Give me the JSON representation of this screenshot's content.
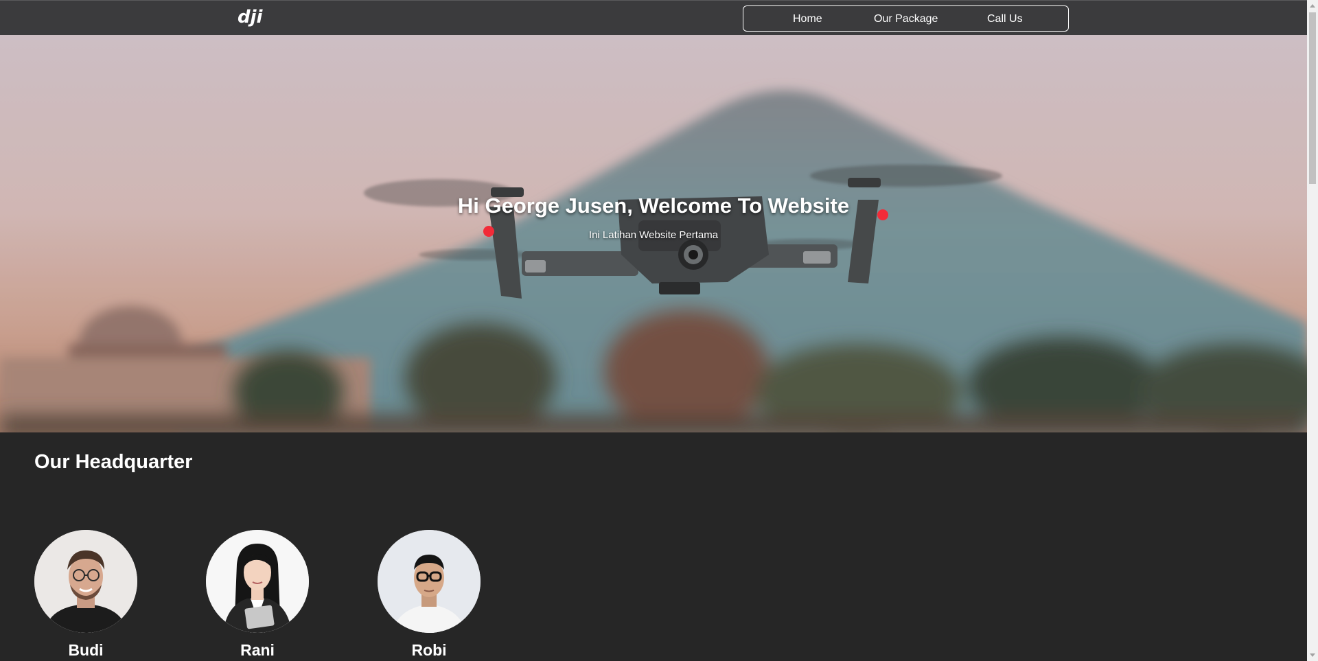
{
  "navbar": {
    "logo_text": "dji",
    "links": [
      {
        "label": "Home"
      },
      {
        "label": "Our Package"
      },
      {
        "label": "Call Us"
      }
    ]
  },
  "hero": {
    "title": "Hi George Jusen, Welcome To Website",
    "subtitle": "Ini Latihan Website Pertama"
  },
  "headquarter": {
    "title": "Our Headquarter",
    "members": [
      {
        "name": "Budi"
      },
      {
        "name": "Rani"
      },
      {
        "name": "Robi"
      }
    ]
  },
  "colors": {
    "navbar_bg": "#3b3b3d",
    "page_bg": "#262626",
    "text": "#ffffff"
  },
  "icons": [
    "dji-logo-icon"
  ]
}
